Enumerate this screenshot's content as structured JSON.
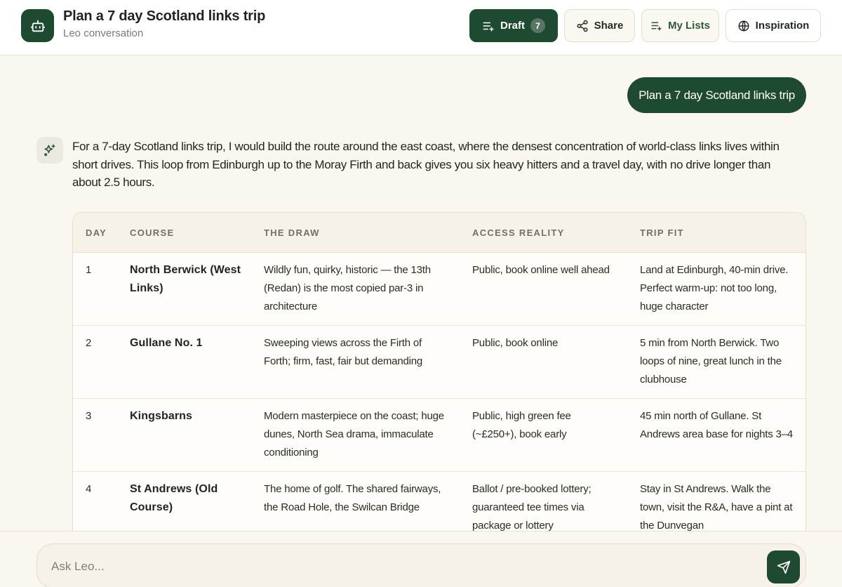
{
  "header": {
    "title": "Plan a 7 day Scotland links trip",
    "subtitle": "Leo conversation",
    "buttons": {
      "draft_label": "Draft",
      "draft_count": "7",
      "share_label": "Share",
      "lists_label": "My Lists",
      "inspiration_label": "Inspiration"
    }
  },
  "conversation": {
    "user_message": "Plan a 7 day Scotland links trip",
    "assistant_message": "For a 7-day Scotland links trip, I would build the route around the east coast, where the densest concentration of world-class links lives within short drives. This loop from Edinburgh up to the Moray Firth and back gives you six heavy hitters and a travel day, with no drive longer than about 2.5 hours."
  },
  "table": {
    "columns": [
      "DAY",
      "COURSE",
      "THE DRAW",
      "ACCESS REALITY",
      "TRIP FIT"
    ],
    "rows": [
      {
        "day": "1",
        "course": "North Berwick (West Links)",
        "draw": "Wildly fun, quirky, historic — the 13th (Redan) is the most copied par-3 in architecture",
        "access": "Public, book online well ahead",
        "fit": "Land at Edinburgh, 40-min drive. Perfect warm-up: not too long, huge character"
      },
      {
        "day": "2",
        "course": "Gullane No. 1",
        "draw": "Sweeping views across the Firth of Forth; firm, fast, fair but demanding",
        "access": "Public, book online",
        "fit": "5 min from North Berwick. Two loops of nine, great lunch in the clubhouse"
      },
      {
        "day": "3",
        "course": "Kingsbarns",
        "draw": "Modern masterpiece on the coast; huge dunes, North Sea drama, immaculate conditioning",
        "access": "Public, high green fee (~£250+), book early",
        "fit": "45 min north of Gullane. St Andrews area base for nights 3–4"
      },
      {
        "day": "4",
        "course": "St Andrews (Old Course)",
        "draw": "The home of golf. The shared fairways, the Road Hole, the Swilcan Bridge",
        "access": "Ballot / pre-booked lottery; guaranteed tee times via package or lottery",
        "fit": "Stay in St Andrews. Walk the town, visit the R&A, have a pint at the Dunvegan"
      }
    ]
  },
  "composer": {
    "placeholder": "Ask Leo..."
  }
}
